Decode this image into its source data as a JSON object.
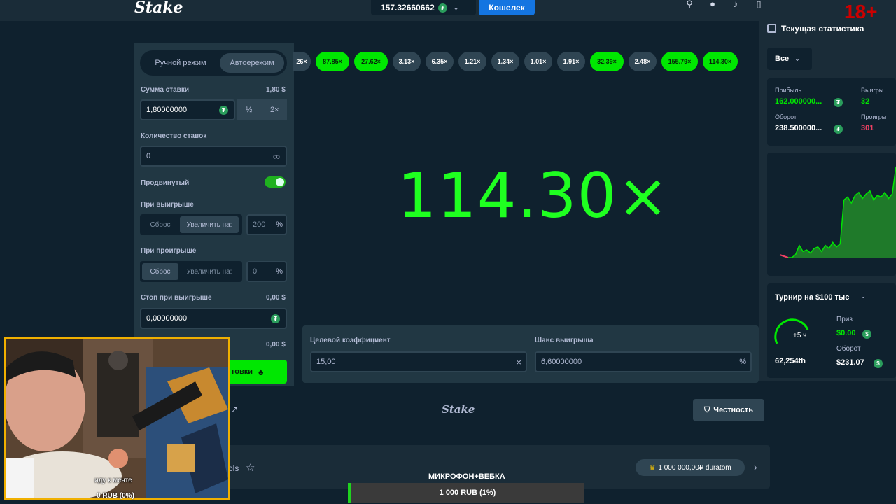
{
  "header": {
    "logo": "Stake",
    "balance": "157.32660662",
    "wallet_label": "Кошелек",
    "age_badge": "18+"
  },
  "mode": {
    "manual": "Ручной режим",
    "auto": "Автоережим"
  },
  "controls": {
    "bet_label": "Сумма ставки",
    "bet_usd": "1,80 $",
    "bet_value": "1,80000000",
    "half": "½",
    "double": "2×",
    "count_label": "Количество ставок",
    "count_value": "0",
    "infinity": "∞",
    "advanced_label": "Продвинутый",
    "on_win_label": "При выигрыше",
    "reset": "Сброс",
    "increase": "Увеличить на:",
    "on_win_value": "200",
    "on_loss_label": "При проигрыше",
    "on_loss_value": "0",
    "pct": "%",
    "stop_win_label": "Стоп при выигрыше",
    "stop_win_usd": "0,00 $",
    "stop_win_value": "0,00000000",
    "stop_loss_usd": "0,00 $",
    "start_btn": "товки"
  },
  "history": [
    {
      "v": "26×",
      "c": "grey"
    },
    {
      "v": "87.85×",
      "c": "green"
    },
    {
      "v": "27.62×",
      "c": "green"
    },
    {
      "v": "3.13×",
      "c": "grey"
    },
    {
      "v": "6.35×",
      "c": "grey"
    },
    {
      "v": "1.21×",
      "c": "grey"
    },
    {
      "v": "1.34×",
      "c": "grey"
    },
    {
      "v": "1.01×",
      "c": "grey"
    },
    {
      "v": "1.91×",
      "c": "grey"
    },
    {
      "v": "32.39×",
      "c": "green"
    },
    {
      "v": "2.48×",
      "c": "grey"
    },
    {
      "v": "155.79×",
      "c": "green"
    },
    {
      "v": "114.30×",
      "c": "green"
    }
  ],
  "game": {
    "multiplier": "114.30×",
    "target_label": "Целевой коэффициент",
    "target_value": "15,00",
    "clear": "×",
    "chance_label": "Шанс выигрыша",
    "chance_value": "6,60000000",
    "chance_unit": "%"
  },
  "stats": {
    "title": "Текущая статистика",
    "filter": "Все",
    "profit_label": "Прибыль",
    "profit_value": "162.000000...",
    "wins_label": "Выигры",
    "wins_value": "32",
    "turnover_label": "Оборот",
    "turnover_value": "238.500000...",
    "losses_label": "Проигры",
    "losses_value": "301",
    "chart_series": [
      0,
      0,
      2,
      8,
      4,
      5,
      3,
      6,
      7,
      4,
      8,
      6,
      10,
      7,
      9,
      38,
      40,
      36,
      41,
      43,
      39,
      42,
      44,
      38,
      41,
      40,
      43,
      39,
      42,
      60
    ]
  },
  "tournament": {
    "title": "Турнир на $100 тыс",
    "timer": "+5 ч",
    "rank": "62,254th",
    "prize_label": "Приз",
    "prize_value": "$0.00",
    "turnover_label": "Оборот",
    "turnover_value": "$231.07"
  },
  "footer": {
    "logo": "Stake",
    "fairness": "Честность",
    "fav_text": "ols",
    "donate": "1 000 000,00₽ duratom",
    "mic_label": "МИКРОФОН+ВЕБКА",
    "goal": "1 000 RUB (1%)"
  },
  "webcam": {
    "caption": "иду к мечте",
    "amount": "0 RUB (0%)"
  },
  "colors": {
    "green": "#00e701",
    "accent_blue": "#1475e1",
    "loss_red": "#ed4163"
  }
}
